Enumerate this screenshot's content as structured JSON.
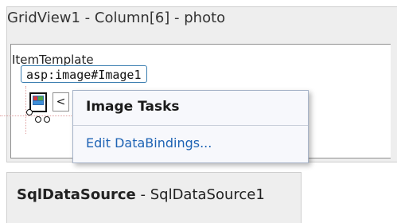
{
  "grid_panel": {
    "title": "GridView1 - Column[6] - photo"
  },
  "item_template": {
    "header": "ItemTemplate"
  },
  "image_control": {
    "tag": "asp:image#Image1"
  },
  "smart_tag": {
    "glyph": "<"
  },
  "tasks_popup": {
    "title": "Image Tasks",
    "items": [
      {
        "label": "Edit DataBindings..."
      }
    ]
  },
  "sql_panel": {
    "type_label": "SqlDataSource",
    "separator": " - ",
    "instance_name": "SqlDataSource1"
  },
  "icons": [
    "image-placeholder-icon",
    "chevron-left-icon"
  ],
  "colors": {
    "link": "#1e63b4",
    "tag_border": "#3c7fb1",
    "popup_bg": "#f7f8fc"
  }
}
